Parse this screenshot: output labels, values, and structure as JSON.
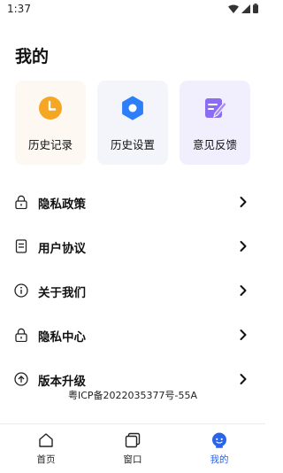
{
  "status_bar": {
    "time": "1:37"
  },
  "page": {
    "title": "我的"
  },
  "cards": {
    "history": {
      "label": "历史记录",
      "icon": "clock-icon"
    },
    "settings": {
      "label": "历史设置",
      "icon": "settings-icon"
    },
    "feedback": {
      "label": "意见反馈",
      "icon": "feedback-icon"
    }
  },
  "menu": {
    "items": [
      {
        "label": "隐私政策",
        "icon": "lock-icon"
      },
      {
        "label": "用户协议",
        "icon": "document-icon"
      },
      {
        "label": "关于我们",
        "icon": "info-icon"
      },
      {
        "label": "隐私中心",
        "icon": "lock-icon"
      },
      {
        "label": "版本升级",
        "icon": "upgrade-icon"
      }
    ]
  },
  "footer": {
    "icp": "粤ICP备2022035377号-55A"
  },
  "tabs": [
    {
      "label": "首页",
      "icon": "home-icon",
      "active": false
    },
    {
      "label": "窗口",
      "icon": "windows-icon",
      "active": false
    },
    {
      "label": "我的",
      "icon": "profile-icon",
      "active": true
    }
  ],
  "colors": {
    "accent": "#2a64e8",
    "history_card_bg": "#fdf8f1",
    "settings_card_bg": "#f3f5fb",
    "feedback_card_bg": "#f1effd",
    "clock_orange": "#f5a623",
    "settings_blue": "#2d7ff9",
    "feedback_purple": "#8c6cf0"
  }
}
